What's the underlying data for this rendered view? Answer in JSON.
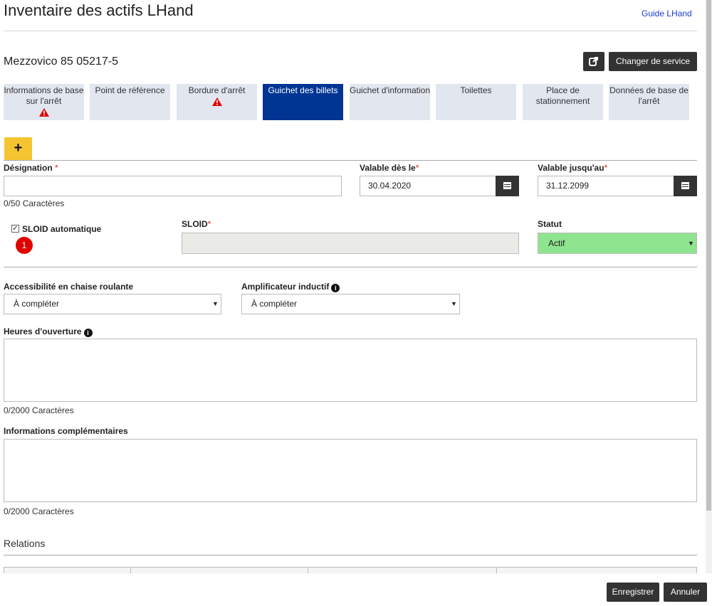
{
  "header": {
    "title": "Inventaire des actifs LHand",
    "guide_link": "Guide LHand"
  },
  "stop": {
    "name": "Mezzovico 85 05217-5",
    "change_service_label": "Changer de service"
  },
  "tabs": [
    {
      "label": "Informations de base sur l'arrêt",
      "warning": true
    },
    {
      "label": "Point de référence",
      "warning": false
    },
    {
      "label": "Bordure d'arrêt",
      "warning": true
    },
    {
      "label": "Guichet des billets",
      "warning": false,
      "active": true
    },
    {
      "label": "Guichet d'information",
      "warning": false
    },
    {
      "label": "Toilettes",
      "warning": false
    },
    {
      "label": "Place de stationnement",
      "warning": false
    },
    {
      "label": "Données de base de l'arrêt",
      "warning": false
    }
  ],
  "form": {
    "add_label": "+",
    "designation": {
      "label": "Désignation",
      "required_mark": "*",
      "value": "",
      "counter": "0/50 Caractères"
    },
    "valid_from": {
      "label": "Valable dès le",
      "required_mark": "*",
      "value": "30.04.2020"
    },
    "valid_until": {
      "label": "Valable jusqu'au",
      "required_mark": "*",
      "value": "31.12.2099"
    },
    "sloid_auto": {
      "label": "SLOID automatique",
      "checked": true,
      "badge": "1"
    },
    "sloid": {
      "label": "SLOID",
      "required_mark": "*",
      "value": ""
    },
    "status": {
      "label": "Statut",
      "value": "Actif",
      "color": "#8fe48f"
    },
    "wheelchair": {
      "label": "Accessibilité en chaise roulante",
      "value": "À compléter"
    },
    "inductive": {
      "label": "Amplificateur inductif",
      "value": "À compléter"
    },
    "opening_hours": {
      "label": "Heures d'ouverture",
      "counter": "0/2000 Caractères"
    },
    "additional_info": {
      "label": "Informations complémentaires",
      "counter": "0/2000 Caractères"
    }
  },
  "relations": {
    "title": "Relations"
  },
  "footer": {
    "save_label": "Enregistrer",
    "cancel_label": "Annuler"
  },
  "colors": {
    "active_tab": "#003594",
    "tab_bg": "#e1e6ef",
    "add_button": "#f5c431",
    "required": "#d9262c",
    "warning": "#e10000"
  }
}
